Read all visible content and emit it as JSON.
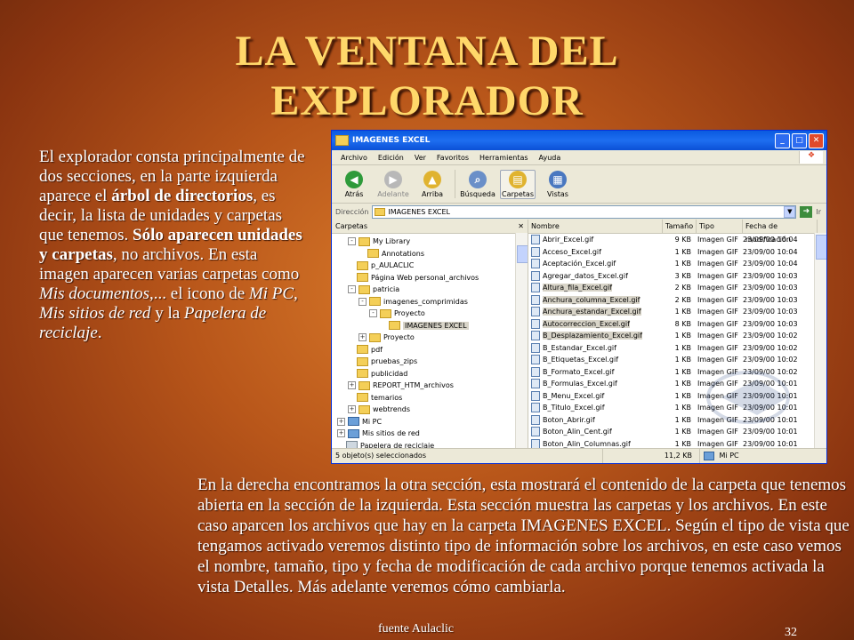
{
  "slide": {
    "title": "LA VENTANA DEL EXPLORADOR",
    "left_text": [
      {
        "t": "El explorador consta principalmente de dos secciones, en la parte izquierda aparece el "
      },
      {
        "t": "árbol de directorios",
        "b": true
      },
      {
        "t": ", es decir, la lista de unidades y carpetas que tenemos. "
      },
      {
        "t": "Sólo aparecen unidades y carpetas",
        "b": true
      },
      {
        "t": ", no archivos. En esta imagen aparecen varias carpetas como "
      },
      {
        "t": "Mis documentos",
        "i": true
      },
      {
        "t": ",... el icono de "
      },
      {
        "t": "Mi PC, Mis sitios de red",
        "i": true
      },
      {
        "t": " y la "
      },
      {
        "t": "Papelera de reciclaje",
        "i": true
      },
      {
        "t": "."
      }
    ],
    "bottom_text": "En la derecha encontramos la otra sección, esta mostrará el contenido de la carpeta que tenemos abierta en la sección de la izquierda. Esta sección muestra las carpetas y los archivos. En este caso aparcen los archivos que hay en la carpeta IMAGENES EXCEL. Según el tipo de vista que tengamos activado veremos distinto tipo de información sobre los archivos, en este caso vemos el nombre, tamaño, tipo y fecha de modificación de cada archivo porque tenemos activada la vista Detalles. Más adelante veremos cómo cambiarla.",
    "source": "fuente Aulaclic",
    "page_number": "32"
  },
  "explorer": {
    "window_title": "IMAGENES EXCEL",
    "menu": [
      "Archivo",
      "Edición",
      "Ver",
      "Favoritos",
      "Herramientas",
      "Ayuda"
    ],
    "toolbar": [
      {
        "label": "Atrás",
        "icon": "back-arrow-icon",
        "color": "#2e9a3a",
        "glyph": "◀"
      },
      {
        "label": "Adelante",
        "icon": "forward-arrow-icon",
        "color": "#b8b8b8",
        "glyph": "▶"
      },
      {
        "label": "Arriba",
        "icon": "folder-up-icon",
        "color": "#e0b330",
        "glyph": "▲"
      },
      {
        "label": "Búsqueda",
        "icon": "search-icon",
        "color": "#6a8fc8",
        "glyph": "⌕"
      },
      {
        "label": "Carpetas",
        "icon": "folders-icon",
        "color": "#e0b330",
        "glyph": "▤"
      },
      {
        "label": "Vistas",
        "icon": "views-icon",
        "color": "#4a78c0",
        "glyph": "▦"
      }
    ],
    "address_label": "Dirección",
    "address_value": "IMAGENES EXCEL",
    "go_label": "Ir",
    "tree_header": "Carpetas",
    "tree": [
      {
        "label": "My Library",
        "indent": 1,
        "pm": "-"
      },
      {
        "label": "Annotations",
        "indent": 2,
        "pm": ""
      },
      {
        "label": "p_AULACLIC",
        "indent": 1,
        "pm": ""
      },
      {
        "label": "Página Web personal_archivos",
        "indent": 1,
        "pm": ""
      },
      {
        "label": "patricia",
        "indent": 1,
        "pm": "-"
      },
      {
        "label": "imagenes_comprimidas",
        "indent": 2,
        "pm": "-"
      },
      {
        "label": "Proyecto",
        "indent": 3,
        "pm": "-"
      },
      {
        "label": "IMAGENES EXCEL",
        "indent": 4,
        "pm": "",
        "selected": true
      },
      {
        "label": "Proyecto",
        "indent": 2,
        "pm": "+"
      },
      {
        "label": "pdf",
        "indent": 1,
        "pm": ""
      },
      {
        "label": "pruebas_zips",
        "indent": 1,
        "pm": ""
      },
      {
        "label": "publicidad",
        "indent": 1,
        "pm": ""
      },
      {
        "label": "REPORT_HTM_archivos",
        "indent": 1,
        "pm": "+"
      },
      {
        "label": "temarios",
        "indent": 1,
        "pm": ""
      },
      {
        "label": "webtrends",
        "indent": 1,
        "pm": "+"
      },
      {
        "label": "Mi PC",
        "indent": 0,
        "pm": "+",
        "kind": "pc"
      },
      {
        "label": "Mis sitios de red",
        "indent": 0,
        "pm": "+",
        "kind": "pc"
      },
      {
        "label": "Papelera de reciclaje",
        "indent": 0,
        "pm": "",
        "kind": "bin"
      }
    ],
    "columns": [
      "Nombre",
      "Tamaño",
      "Tipo",
      "Fecha de modificación"
    ],
    "files": [
      {
        "name": "Abrir_Excel.gif",
        "size": "9 KB",
        "type": "Imagen GIF",
        "date": "23/09/00 10:04"
      },
      {
        "name": "Acceso_Excel.gif",
        "size": "1 KB",
        "type": "Imagen GIF",
        "date": "23/09/00 10:04"
      },
      {
        "name": "Aceptación_Excel.gif",
        "size": "1 KB",
        "type": "Imagen GIF",
        "date": "23/09/00 10:04"
      },
      {
        "name": "Agregar_datos_Excel.gif",
        "size": "3 KB",
        "type": "Imagen GIF",
        "date": "23/09/00 10:03"
      },
      {
        "name": "Altura_fila_Excel.gif",
        "size": "2 KB",
        "type": "Imagen GIF",
        "date": "23/09/00 10:03",
        "selected": true
      },
      {
        "name": "Anchura_columna_Excel.gif",
        "size": "2 KB",
        "type": "Imagen GIF",
        "date": "23/09/00 10:03",
        "selected": true
      },
      {
        "name": "Anchura_estandar_Excel.gif",
        "size": "1 KB",
        "type": "Imagen GIF",
        "date": "23/09/00 10:03",
        "selected": true
      },
      {
        "name": "Autocorreccion_Excel.gif",
        "size": "8 KB",
        "type": "Imagen GIF",
        "date": "23/09/00 10:03",
        "selected": true
      },
      {
        "name": "B_Desplazamiento_Excel.gif",
        "size": "1 KB",
        "type": "Imagen GIF",
        "date": "23/09/00 10:02",
        "selected": true
      },
      {
        "name": "B_Estandar_Excel.gif",
        "size": "1 KB",
        "type": "Imagen GIF",
        "date": "23/09/00 10:02"
      },
      {
        "name": "B_Etiquetas_Excel.gif",
        "size": "1 KB",
        "type": "Imagen GIF",
        "date": "23/09/00 10:02"
      },
      {
        "name": "B_Formato_Excel.gif",
        "size": "1 KB",
        "type": "Imagen GIF",
        "date": "23/09/00 10:02"
      },
      {
        "name": "B_Formulas_Excel.gif",
        "size": "1 KB",
        "type": "Imagen GIF",
        "date": "23/09/00 10:01"
      },
      {
        "name": "B_Menu_Excel.gif",
        "size": "1 KB",
        "type": "Imagen GIF",
        "date": "23/09/00 10:01"
      },
      {
        "name": "B_Titulo_Excel.gif",
        "size": "1 KB",
        "type": "Imagen GIF",
        "date": "23/09/00 10:01"
      },
      {
        "name": "Boton_Abrir.gif",
        "size": "1 KB",
        "type": "Imagen GIF",
        "date": "23/09/00 10:01"
      },
      {
        "name": "Boton_Alin_Cent.gif",
        "size": "1 KB",
        "type": "Imagen GIF",
        "date": "23/09/00 10:01"
      },
      {
        "name": "Boton_Alin_Columnas.gif",
        "size": "1 KB",
        "type": "Imagen GIF",
        "date": "23/09/00 10:01"
      }
    ],
    "status": {
      "selection": "5 objeto(s) seleccionados",
      "size": "11,2 KB",
      "location": "Mi PC"
    }
  }
}
